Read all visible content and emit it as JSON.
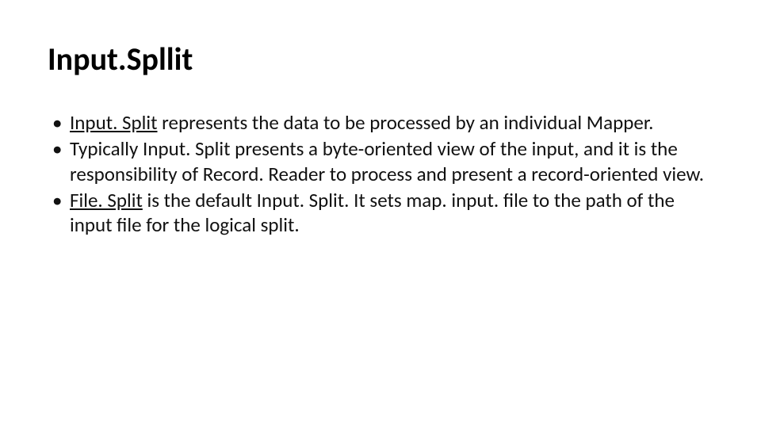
{
  "title": "Input.Spllit",
  "bullets": {
    "b1_link": "Input. Split",
    "b1_rest": " represents the data to be processed by an individual Mapper.",
    "b2": "Typically Input. Split presents a byte-oriented view of the input, and it is the responsibility of Record. Reader to process and present a record-oriented view.",
    "b3_link": "File. Split",
    "b3_rest": " is the default Input. Split. It sets map. input. file to the path of the input file for the logical split."
  }
}
